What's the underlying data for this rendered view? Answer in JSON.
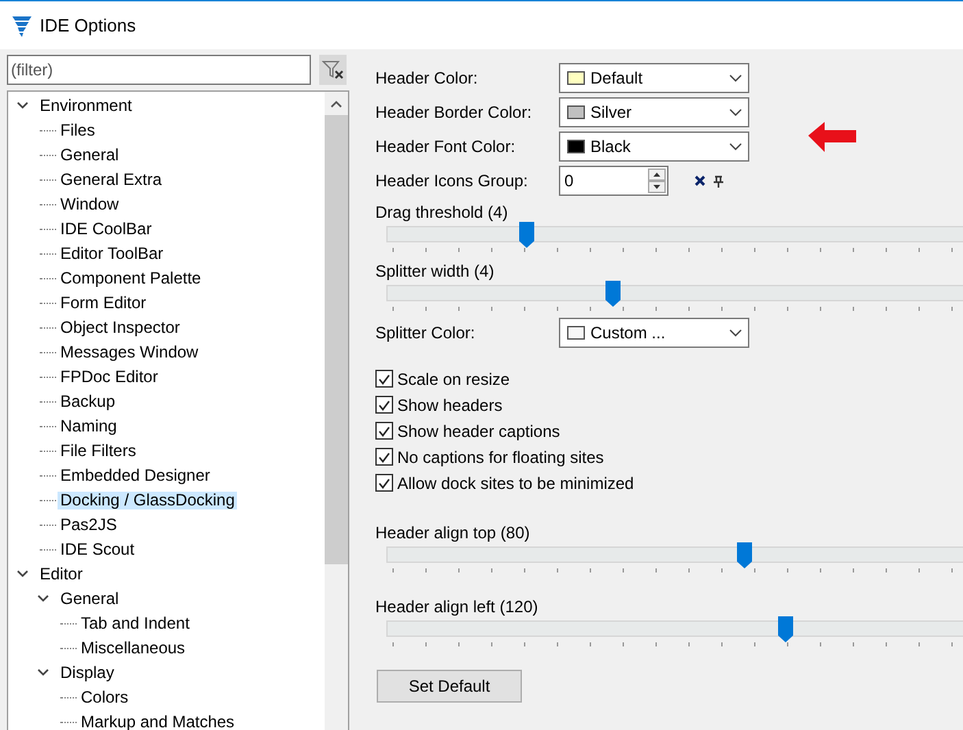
{
  "window": {
    "title": "IDE Options"
  },
  "filter": {
    "placeholder": "(filter)"
  },
  "tree": [
    {
      "label": "Environment",
      "expanded": true,
      "selected": false,
      "children": [
        {
          "label": "Files",
          "selected": false
        },
        {
          "label": "General",
          "selected": false
        },
        {
          "label": "General Extra",
          "selected": false
        },
        {
          "label": "Window",
          "selected": false
        },
        {
          "label": "IDE CoolBar",
          "selected": false
        },
        {
          "label": "Editor ToolBar",
          "selected": false
        },
        {
          "label": "Component Palette",
          "selected": false
        },
        {
          "label": "Form Editor",
          "selected": false
        },
        {
          "label": "Object Inspector",
          "selected": false
        },
        {
          "label": "Messages Window",
          "selected": false
        },
        {
          "label": "FPDoc Editor",
          "selected": false
        },
        {
          "label": "Backup",
          "selected": false
        },
        {
          "label": "Naming",
          "selected": false
        },
        {
          "label": "File Filters",
          "selected": false
        },
        {
          "label": "Embedded Designer",
          "selected": false
        },
        {
          "label": "Docking / GlassDocking",
          "selected": true
        },
        {
          "label": "Pas2JS",
          "selected": false
        },
        {
          "label": "IDE Scout",
          "selected": false
        }
      ]
    },
    {
      "label": "Editor",
      "expanded": true,
      "selected": false,
      "children": [
        {
          "label": "General",
          "expanded": true,
          "selected": false,
          "children": [
            {
              "label": "Tab and Indent",
              "selected": false
            },
            {
              "label": "Miscellaneous",
              "selected": false
            }
          ]
        },
        {
          "label": "Display",
          "expanded": true,
          "selected": false,
          "children": [
            {
              "label": "Colors",
              "selected": false
            },
            {
              "label": "Markup and Matches",
              "selected": false
            }
          ]
        }
      ]
    }
  ],
  "fields": [
    {
      "kind": "color_select",
      "label": "Header Color:",
      "value": "Default",
      "color": "#ffffc0"
    },
    {
      "kind": "color_select",
      "label": "Header Border Color:",
      "value": "Silver",
      "color": "#c0c0c0"
    },
    {
      "kind": "color_select",
      "label": "Header Font Color:",
      "value": "Black",
      "color": "#000000"
    },
    {
      "kind": "spin",
      "label": "Header Icons Group:",
      "value": "0"
    }
  ],
  "sliders_top": [
    {
      "label": "Drag threshold (4)",
      "level": 0.24
    },
    {
      "label": "Splitter width (4)",
      "level": 0.39
    }
  ],
  "splitter_color": {
    "label": "Splitter Color:",
    "value": "Custom ...",
    "color": "#f8f8f8"
  },
  "checkboxes": [
    {
      "label": "Scale on resize",
      "checked": true
    },
    {
      "label": "Show headers",
      "checked": true
    },
    {
      "label": "Show header captions",
      "checked": true
    },
    {
      "label": "No captions for floating sites",
      "checked": true
    },
    {
      "label": "Allow dock sites to be minimized",
      "checked": true
    }
  ],
  "sliders_bottom": [
    {
      "label": "Header align top (80)",
      "level": 0.62
    },
    {
      "label": "Header align left (120)",
      "level": 0.69
    }
  ],
  "button": "Set Default"
}
